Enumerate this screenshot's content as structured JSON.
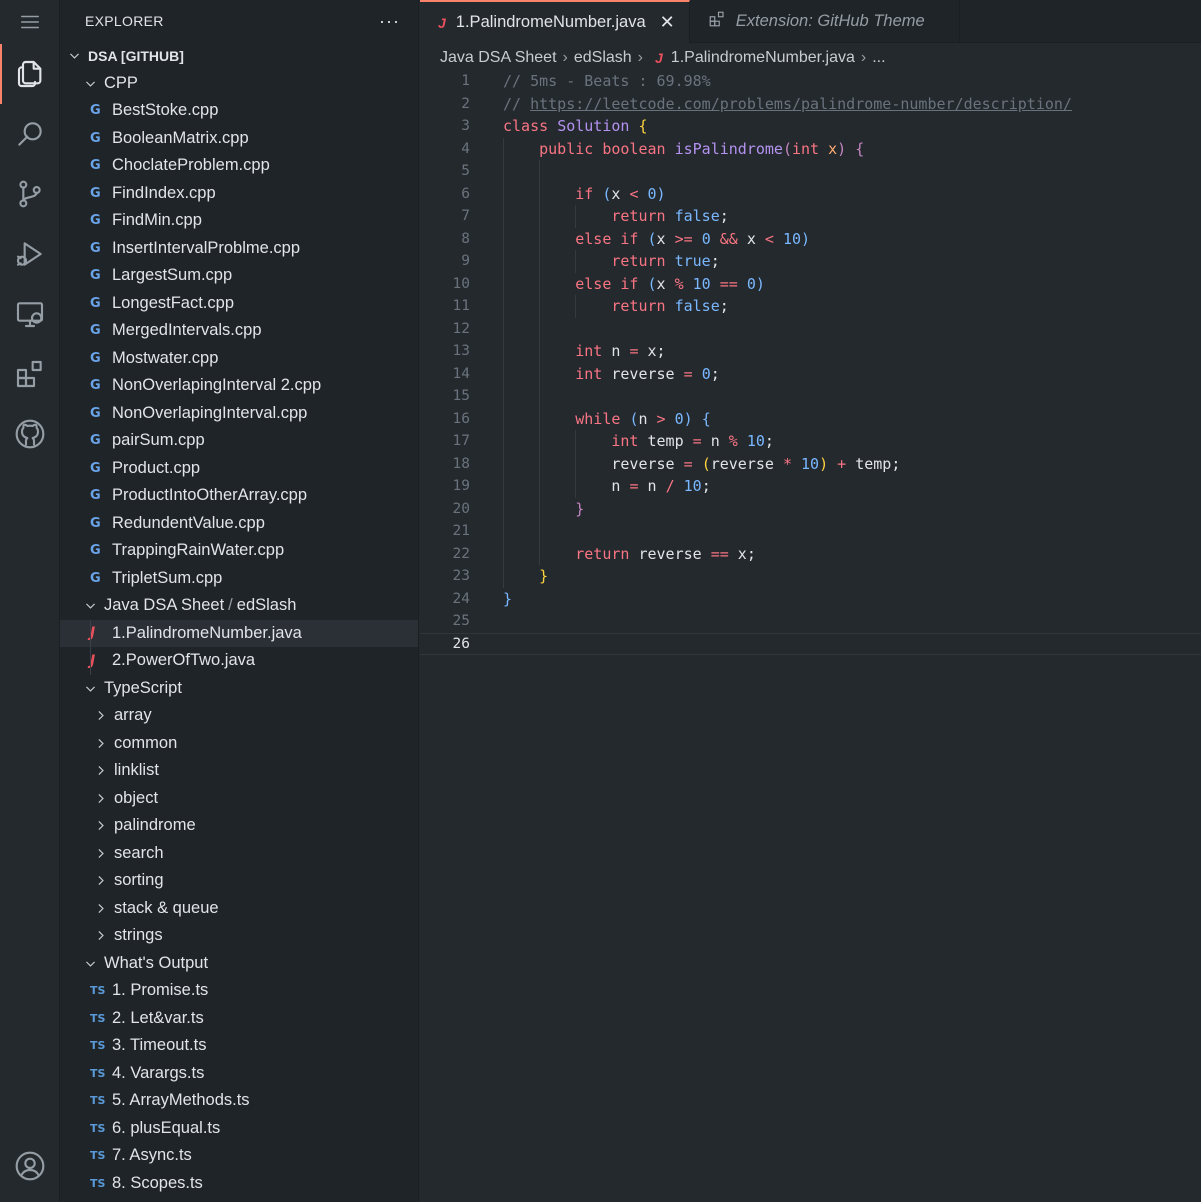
{
  "colors": {
    "accent": "#f9826c",
    "keyword": "#f97583",
    "function": "#b392f0",
    "constant": "#79b8ff",
    "param": "#ffab70",
    "comment": "#6a737d"
  },
  "activity_bar": {
    "items": [
      {
        "name": "explorer-icon",
        "active": true
      },
      {
        "name": "search-icon"
      },
      {
        "name": "source-control-icon"
      },
      {
        "name": "run-debug-icon"
      },
      {
        "name": "remote-explorer-icon"
      },
      {
        "name": "extensions-icon"
      },
      {
        "name": "github-icon"
      },
      {
        "name": "account-icon"
      }
    ]
  },
  "sidebar": {
    "title": "EXPLORER",
    "more": "···",
    "workspace": "DSA [GITHUB]",
    "cpp_folder": "CPP",
    "cpp_files": [
      "BestStoke.cpp",
      "BooleanMatrix.cpp",
      "ChoclateProblem.cpp",
      "FindIndex.cpp",
      "FindMin.cpp",
      "InsertIntervalProblme.cpp",
      "LargestSum.cpp",
      "LongestFact.cpp",
      "MergedIntervals.cpp",
      "Mostwater.cpp",
      "NonOverlapingInterval 2.cpp",
      "NonOverlapingInterval.cpp",
      "pairSum.cpp",
      "Product.cpp",
      "ProductIntoOtherArray.cpp",
      "RedundentValue.cpp",
      "TrappingRainWater.cpp",
      "TripletSum.cpp"
    ],
    "java_folder": "Java DSA Sheet",
    "java_subfolder": "edSlash",
    "java_files": [
      "1.PalindromeNumber.java",
      "2.PowerOfTwo.java"
    ],
    "ts_folder": "TypeScript",
    "ts_subfolders": [
      "array",
      "common",
      "linklist",
      "object",
      "palindrome",
      "search",
      "sorting",
      "stack & queue",
      "strings"
    ],
    "output_folder": "What's Output",
    "output_files": [
      "1. Promise.ts",
      "2. Let&var.ts",
      "3. Timeout.ts",
      "4. Varargs.ts",
      "5. ArrayMethods.ts",
      "6. plusEqual.ts",
      "7. Async.ts",
      "8. Scopes.ts"
    ],
    "cpp_icon": "G",
    "java_icon": "J",
    "ts_icon": "TS"
  },
  "tabs": [
    {
      "label": "1.PalindromeNumber.java",
      "icon": "J",
      "close": "✕",
      "active": true
    },
    {
      "label": "Extension: GitHub Theme",
      "icon": "extensions-icon",
      "active": false
    }
  ],
  "breadcrumbs": [
    "Java DSA Sheet",
    "edSlash",
    "1.PalindromeNumber.java",
    "..."
  ],
  "editor": {
    "current_line": 26,
    "lines": [
      [
        [
          "c",
          "// 5ms - Beats : 69.98%"
        ]
      ],
      [
        [
          "c",
          "// "
        ],
        [
          "u",
          "https://leetcode.com/problems/palindrome-number/description/"
        ]
      ],
      [
        [
          "k",
          "class "
        ],
        [
          "t",
          "Solution "
        ],
        [
          "b1",
          "{"
        ]
      ],
      [
        [
          "",
          "    "
        ],
        [
          "k",
          "public boolean "
        ],
        [
          "t",
          "isPalindrome"
        ],
        [
          "b2",
          "("
        ],
        [
          "k",
          "int "
        ],
        [
          "v",
          "x"
        ],
        [
          "b2",
          ")"
        ],
        [
          "",
          " "
        ],
        [
          "b2",
          "{"
        ]
      ],
      [],
      [
        [
          "",
          "        "
        ],
        [
          "k",
          "if "
        ],
        [
          "b3",
          "("
        ],
        [
          "",
          "x "
        ],
        [
          "k",
          "<"
        ],
        [
          "",
          " "
        ],
        [
          "n",
          "0"
        ],
        [
          "b3",
          ")"
        ]
      ],
      [
        [
          "",
          "            "
        ],
        [
          "k",
          "return "
        ],
        [
          "n",
          "false"
        ],
        [
          "",
          ";"
        ]
      ],
      [
        [
          "",
          "        "
        ],
        [
          "k",
          "else if "
        ],
        [
          "b3",
          "("
        ],
        [
          "",
          "x "
        ],
        [
          "k",
          ">="
        ],
        [
          "",
          " "
        ],
        [
          "n",
          "0"
        ],
        [
          "",
          " "
        ],
        [
          "k",
          "&&"
        ],
        [
          "",
          " x "
        ],
        [
          "k",
          "<"
        ],
        [
          "",
          " "
        ],
        [
          "n",
          "10"
        ],
        [
          "b3",
          ")"
        ]
      ],
      [
        [
          "",
          "            "
        ],
        [
          "k",
          "return "
        ],
        [
          "n",
          "true"
        ],
        [
          "",
          ";"
        ]
      ],
      [
        [
          "",
          "        "
        ],
        [
          "k",
          "else if "
        ],
        [
          "b3",
          "("
        ],
        [
          "",
          "x "
        ],
        [
          "k",
          "%"
        ],
        [
          "",
          " "
        ],
        [
          "n",
          "10"
        ],
        [
          "",
          " "
        ],
        [
          "k",
          "=="
        ],
        [
          "",
          " "
        ],
        [
          "n",
          "0"
        ],
        [
          "b3",
          ")"
        ]
      ],
      [
        [
          "",
          "            "
        ],
        [
          "k",
          "return "
        ],
        [
          "n",
          "false"
        ],
        [
          "",
          ";"
        ]
      ],
      [],
      [
        [
          "",
          "        "
        ],
        [
          "k",
          "int "
        ],
        [
          "",
          "n "
        ],
        [
          "k",
          "="
        ],
        [
          "",
          " x;"
        ]
      ],
      [
        [
          "",
          "        "
        ],
        [
          "k",
          "int "
        ],
        [
          "",
          "reverse "
        ],
        [
          "k",
          "="
        ],
        [
          "",
          " "
        ],
        [
          "n",
          "0"
        ],
        [
          "",
          ";"
        ]
      ],
      [],
      [
        [
          "",
          "        "
        ],
        [
          "k",
          "while "
        ],
        [
          "b3",
          "("
        ],
        [
          "",
          "n "
        ],
        [
          "k",
          ">"
        ],
        [
          "",
          " "
        ],
        [
          "n",
          "0"
        ],
        [
          "b3",
          ")"
        ],
        [
          "",
          " "
        ],
        [
          "b3",
          "{"
        ]
      ],
      [
        [
          "",
          "            "
        ],
        [
          "k",
          "int "
        ],
        [
          "",
          "temp "
        ],
        [
          "k",
          "="
        ],
        [
          "",
          " n "
        ],
        [
          "k",
          "%"
        ],
        [
          "",
          " "
        ],
        [
          "n",
          "10"
        ],
        [
          "",
          ";"
        ]
      ],
      [
        [
          "",
          "            "
        ],
        [
          "",
          "reverse "
        ],
        [
          "k",
          "="
        ],
        [
          "",
          " "
        ],
        [
          "b1",
          "("
        ],
        [
          "",
          "reverse "
        ],
        [
          "k",
          "*"
        ],
        [
          "",
          " "
        ],
        [
          "n",
          "10"
        ],
        [
          "b1",
          ")"
        ],
        [
          "",
          " "
        ],
        [
          "k",
          "+"
        ],
        [
          "",
          " temp;"
        ]
      ],
      [
        [
          "",
          "            "
        ],
        [
          "",
          "n "
        ],
        [
          "k",
          "="
        ],
        [
          "",
          " n "
        ],
        [
          "k",
          "/"
        ],
        [
          "",
          " "
        ],
        [
          "n",
          "10"
        ],
        [
          "",
          ";"
        ]
      ],
      [
        [
          "",
          "        "
        ],
        [
          "b2",
          "}"
        ]
      ],
      [],
      [
        [
          "",
          "        "
        ],
        [
          "k",
          "return "
        ],
        [
          "",
          "reverse "
        ],
        [
          "k",
          "=="
        ],
        [
          "",
          " x;"
        ]
      ],
      [
        [
          "",
          "    "
        ],
        [
          "b1",
          "}"
        ]
      ],
      [
        [
          "b3",
          "}"
        ]
      ],
      [],
      []
    ]
  }
}
